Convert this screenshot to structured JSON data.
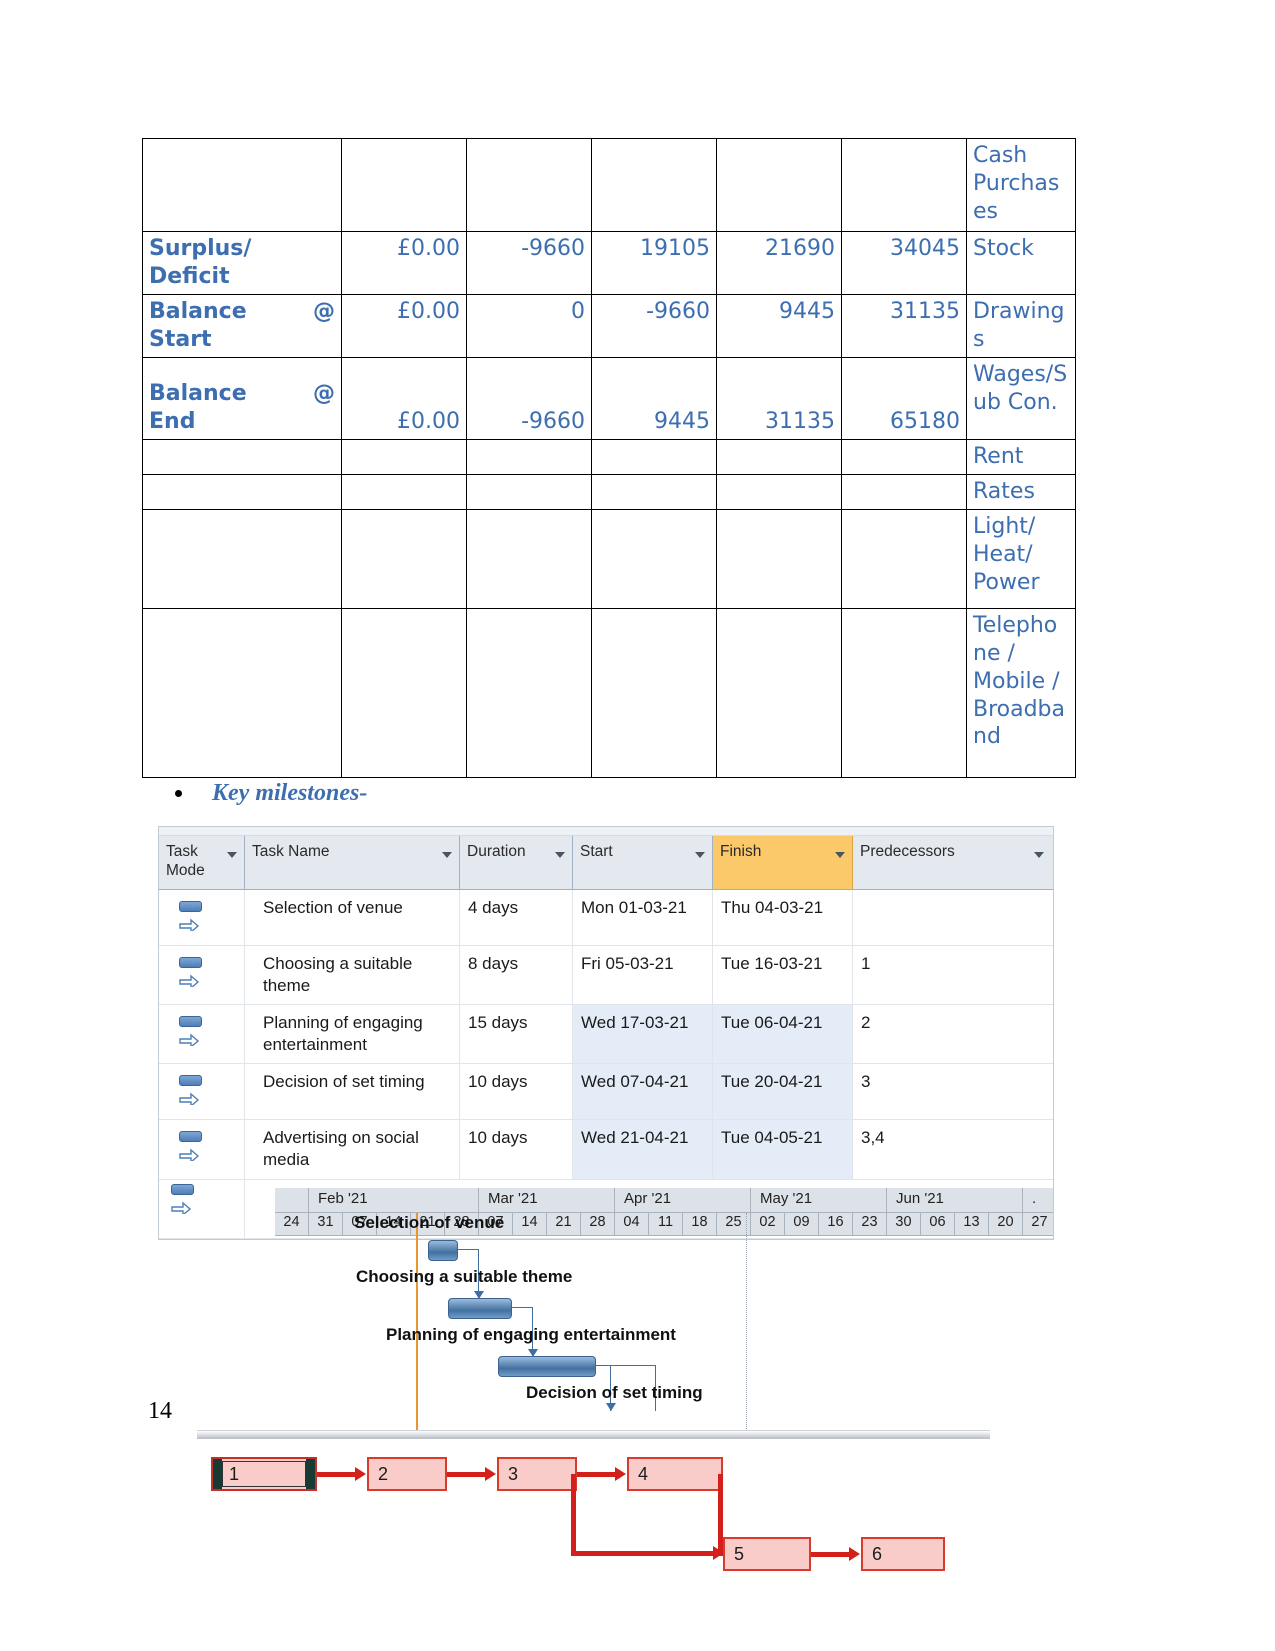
{
  "finance_table": {
    "columns": [
      "label",
      "col1",
      "col2",
      "col3",
      "col4",
      "col5",
      "category"
    ],
    "rows": [
      {
        "type": "blank",
        "label": "",
        "at": "",
        "values": [
          "",
          "",
          "",
          "",
          ""
        ],
        "category": "Cash Purchases"
      },
      {
        "type": "data",
        "label": "Surplus/ Deficit",
        "at": "",
        "values": [
          "£0.00",
          "-9660",
          "19105",
          "21690",
          "34045"
        ],
        "category": "Stock"
      },
      {
        "type": "data",
        "label": "Balance",
        "at": "@",
        "label2": "Start",
        "values": [
          "£0.00",
          "0",
          "-9660",
          "9445",
          "31135"
        ],
        "category": "Drawings"
      },
      {
        "type": "data",
        "label": "Balance",
        "at": "@",
        "label2": "End",
        "values": [
          "£0.00",
          "-9660",
          "9445",
          "31135",
          "65180"
        ],
        "category": "Wages/Sub Con."
      },
      {
        "type": "empty",
        "label": "",
        "at": "",
        "values": [
          "",
          "",
          "",
          "",
          ""
        ],
        "category": "Rent"
      },
      {
        "type": "empty",
        "label": "",
        "at": "",
        "values": [
          "",
          "",
          "",
          "",
          ""
        ],
        "category": "Rates"
      },
      {
        "type": "empty",
        "label": "",
        "at": "",
        "values": [
          "",
          "",
          "",
          "",
          ""
        ],
        "category": "Light/ Heat/ Power"
      },
      {
        "type": "empty",
        "label": "",
        "at": "",
        "values": [
          "",
          "",
          "",
          "",
          ""
        ],
        "category": "Telephone / Mobile / Broadband"
      }
    ],
    "cells": {
      "r0_label": "",
      "r0_at": "",
      "r0_v0": "",
      "r0_v1": "",
      "r0_v2": "",
      "r0_v3": "",
      "r0_v4": "",
      "r0_cat": "Cash Purchases",
      "r1_label": "Surplus/ Deficit",
      "r1_at": "",
      "r1_v0": "£0.00",
      "r1_v1": "-9660",
      "r1_v2": "19105",
      "r1_v3": "21690",
      "r1_v4": "34045",
      "r1_cat": "Stock",
      "r2_label": "Balance",
      "r2_at": "@",
      "r2_label2": "Start",
      "r2_v0": "£0.00",
      "r2_v1": "0",
      "r2_v2": "-9660",
      "r2_v3": "9445",
      "r2_v4": "31135",
      "r2_cat": "Drawings",
      "r3_label": "Balance",
      "r3_at": "@",
      "r3_label2": "End",
      "r3_v0": "£0.00",
      "r3_v1": "-9660",
      "r3_v2": "9445",
      "r3_v3": "31135",
      "r3_v4": "65180",
      "r3_cat": "Wages/Sub Con.",
      "r4_cat": "Rent",
      "r5_cat": "Rates",
      "r6_cat": "Light/ Heat/ Power",
      "r7_cat": "Telephone / Mobile / Broadband"
    },
    "accent_color": "#3d6eb0"
  },
  "bullet": {
    "text": "Key milestones-"
  },
  "project": {
    "columns": [
      {
        "key": "task_mode",
        "label": "Task Mode",
        "selected": false
      },
      {
        "key": "task_name",
        "label": "Task Name",
        "selected": false
      },
      {
        "key": "duration",
        "label": "Duration",
        "selected": false
      },
      {
        "key": "start",
        "label": "Start",
        "selected": false
      },
      {
        "key": "finish",
        "label": "Finish",
        "selected": true
      },
      {
        "key": "predecessors",
        "label": "Predecessors",
        "selected": false
      }
    ],
    "selected_column_color": "#fbc96a",
    "header": {
      "task_mode": "Task Mode",
      "task_name": "Task Name",
      "duration": "Duration",
      "start": "Start",
      "finish": "Finish",
      "predecessors": "Predecessors"
    },
    "rows": [
      {
        "id": 1,
        "name": "Selection of venue",
        "duration": "4 days",
        "start": "Mon 01-03-21",
        "finish": "Thu 04-03-21",
        "pred": ""
      },
      {
        "id": 2,
        "name": "Choosing a suitable theme",
        "duration": "8 days",
        "start": "Fri 05-03-21",
        "finish": "Tue 16-03-21",
        "pred": "1"
      },
      {
        "id": 3,
        "name": "Planning of engaging entertainment",
        "duration": "15 days",
        "start": "Wed 17-03-21",
        "finish": "Tue 06-04-21",
        "pred": "2"
      },
      {
        "id": 4,
        "name": "Decision of set timing",
        "duration": "10 days",
        "start": "Wed 07-04-21",
        "finish": "Tue 20-04-21",
        "pred": "3"
      },
      {
        "id": 5,
        "name": "Advertising on social media",
        "duration": "10 days",
        "start": "Wed 21-04-21",
        "finish": "Tue 04-05-21",
        "pred": "3,4"
      }
    ],
    "row_cells": {
      "t0_name": "Selection of venue",
      "t0_dur": "4 days",
      "t0_start": "Mon 01-03-21",
      "t0_fin": "Thu 04-03-21",
      "t0_pred": "",
      "t1_name": "Choosing a suitable theme",
      "t1_dur": "8 days",
      "t1_start": "Fri 05-03-21",
      "t1_fin": "Tue 16-03-21",
      "t1_pred": "1",
      "t2_name": "Planning of engaging entertainment",
      "t2_dur": "15 days",
      "t2_start": "Wed 17-03-21",
      "t2_fin": "Tue 06-04-21",
      "t2_pred": "2",
      "t3_name": "Decision of set timing",
      "t3_dur": "10 days",
      "t3_start": "Wed 07-04-21",
      "t3_fin": "Tue 20-04-21",
      "t3_pred": "3",
      "t4_name": "Advertising on social media",
      "t4_dur": "10 days",
      "t4_start": "Wed 21-04-21",
      "t4_fin": "Tue 04-05-21",
      "t4_pred": "3,4"
    }
  },
  "timeline": {
    "months": [
      {
        "label": "Feb '21",
        "weeks": 5
      },
      {
        "label": "Mar '21",
        "weeks": 4
      },
      {
        "label": "Apr '21",
        "weeks": 4
      },
      {
        "label": "May '21",
        "weeks": 5
      },
      {
        "label": "Jun '21",
        "weeks": 4
      },
      {
        "label": ".",
        "weeks": 1
      }
    ],
    "month_labels": {
      "m0": "Feb '21",
      "m1": "Mar '21",
      "m2": "Apr '21",
      "m3": "May '21",
      "m4": "Jun '21",
      "m5": "."
    },
    "weeks": [
      "24",
      "31",
      "07",
      "14",
      "21",
      "28",
      "07",
      "14",
      "21",
      "28",
      "04",
      "11",
      "18",
      "25",
      "02",
      "09",
      "16",
      "23",
      "30",
      "06",
      "13",
      "20",
      "27"
    ],
    "week_cells": {
      "w0": "24",
      "w1": "31",
      "w2": "07",
      "w3": "14",
      "w4": "21",
      "w5": "28",
      "w6": "07",
      "w7": "14",
      "w8": "21",
      "w9": "28",
      "w10": "04",
      "w11": "11",
      "w12": "18",
      "w13": "25",
      "w14": "02",
      "w15": "09",
      "w16": "16",
      "w17": "23",
      "w18": "30",
      "w19": "06",
      "w20": "13",
      "w21": "20",
      "w22": "27"
    }
  },
  "gantt_bars": {
    "bar_color": "#4e7fb8",
    "labels": {
      "b0": "Selection of venue",
      "b1": "Choosing a suitable theme",
      "b2": "Planning of engaging entertainment",
      "b3": "Decision of set timing"
    }
  },
  "footer": {
    "page_number": "14"
  },
  "network_diagram": {
    "node_fill": "#f9ccc9",
    "node_border": "#d93a2b",
    "link_color": "#d4201a",
    "nodes": {
      "n1": "1",
      "n2": "2",
      "n3": "3",
      "n4": "4",
      "n5": "5",
      "n6": "6"
    }
  }
}
